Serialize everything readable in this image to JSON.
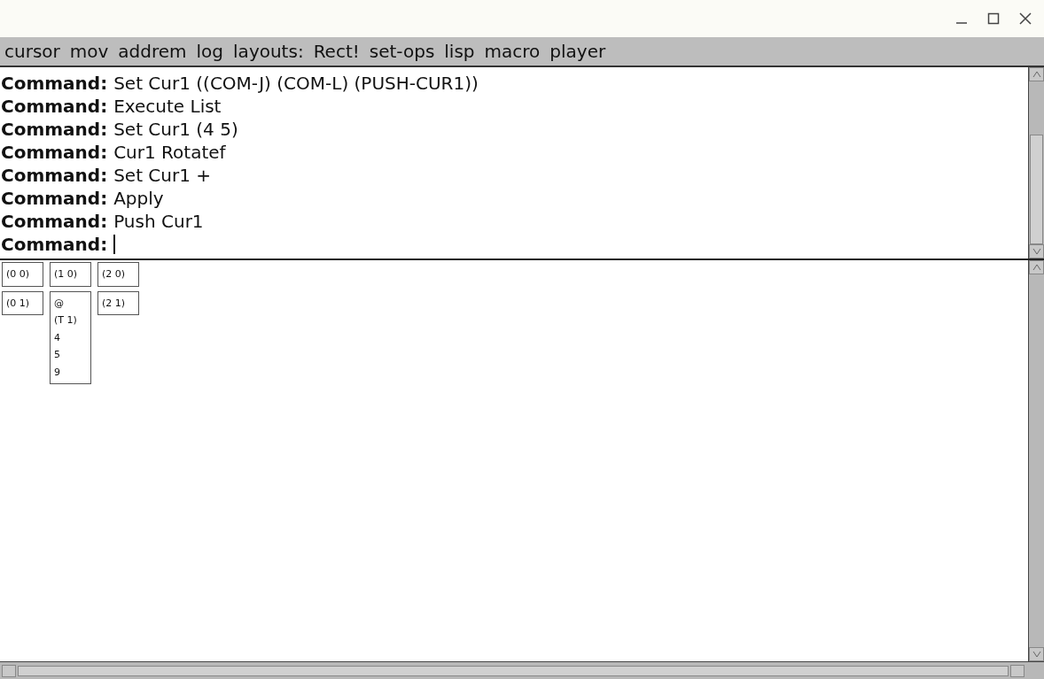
{
  "menu_bar": [
    "cursor",
    "mov",
    "addrem",
    "log",
    "layouts:",
    "Rect!",
    "set-ops",
    "lisp",
    "macro",
    "player"
  ],
  "log": {
    "lines": [
      {
        "prompt": "Command:",
        "text": "Set Cur1 ((COM-J) (COM-L) (PUSH-CUR1))"
      },
      {
        "prompt": "Command:",
        "text": "Execute List"
      },
      {
        "prompt": "Command:",
        "text": "Set Cur1 (4 5)"
      },
      {
        "prompt": "Command:",
        "text": "Cur1 Rotatef"
      },
      {
        "prompt": "Command:",
        "text": "Set Cur1 +"
      },
      {
        "prompt": "Command:",
        "text": "Apply"
      },
      {
        "prompt": "Command:",
        "text": "Push Cur1"
      }
    ],
    "input_prompt": "Command:"
  },
  "grid": {
    "columns": [
      [
        {
          "lines": [
            "(0 0)"
          ]
        },
        {
          "lines": [
            "(0 1)"
          ]
        }
      ],
      [
        {
          "lines": [
            "(1 0)"
          ]
        },
        {
          "lines": [
            "@",
            "(T 1)",
            "4",
            "5",
            "9"
          ]
        }
      ],
      [
        {
          "lines": [
            "(2 0)"
          ]
        },
        {
          "lines": [
            "(2 1)"
          ]
        }
      ]
    ]
  }
}
